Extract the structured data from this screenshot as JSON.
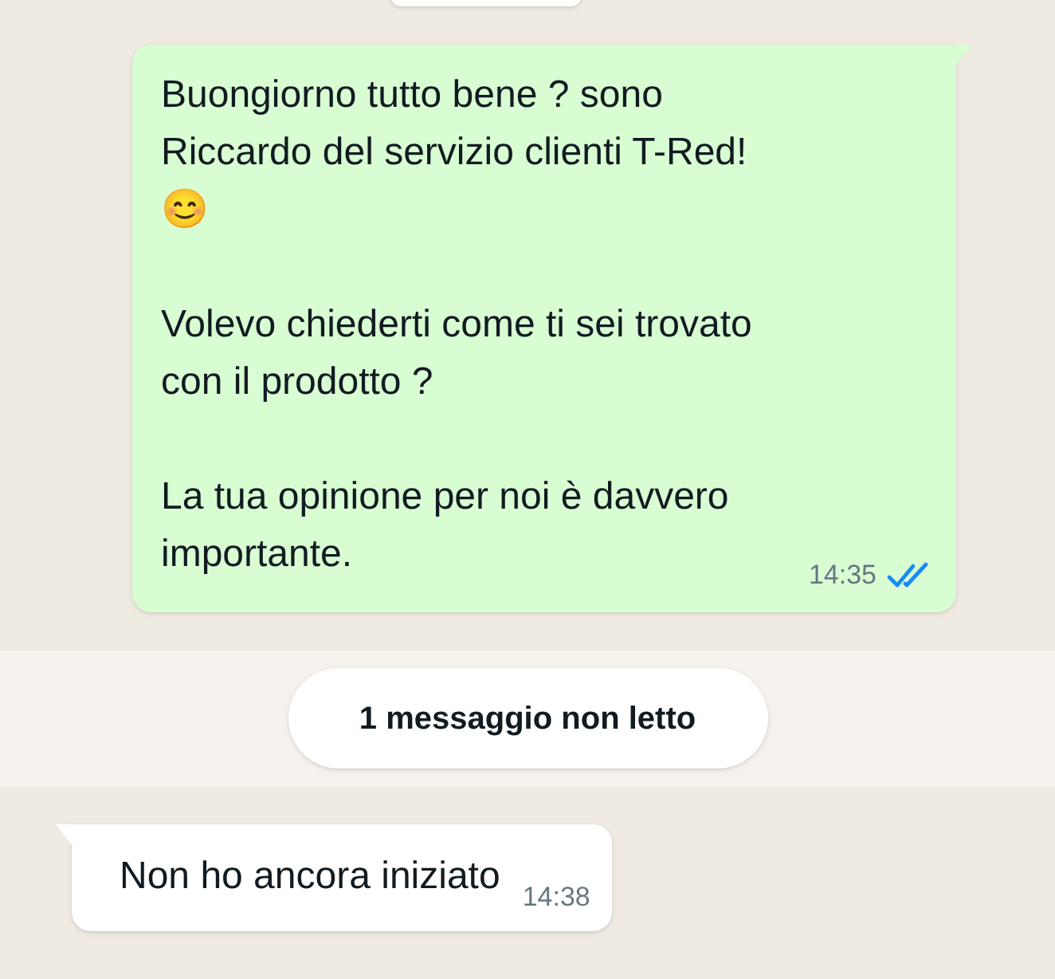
{
  "messages": [
    {
      "kind": "outgoing",
      "text": "Buongiorno tutto bene ? sono\nRiccardo del servizio clienti T-Red!\n😊\n\nVolevo chiederti come ti sei trovato\ncon il prodotto ?\n\nLa tua opinione per noi è davvero\nimportante.",
      "time": "14:35",
      "read": true
    },
    {
      "kind": "unread_banner",
      "text": "1 messaggio non letto"
    },
    {
      "kind": "incoming",
      "text": "Non ho ancora iniziato",
      "time": "14:38"
    }
  ]
}
